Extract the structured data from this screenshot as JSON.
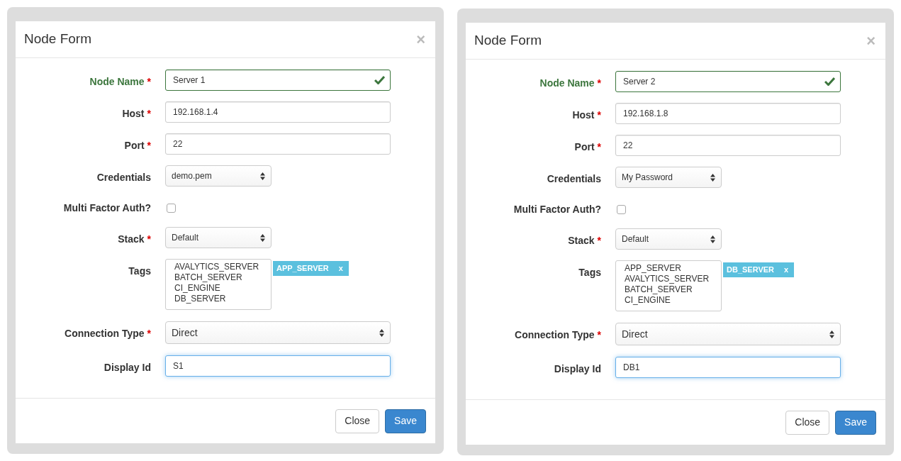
{
  "forms": [
    {
      "title": "Node Form",
      "close_symbol": "×",
      "fields": [
        {
          "kind": "text",
          "label": "Node Name",
          "required_mark": "*",
          "value": "Server 1",
          "valid": true,
          "focused": false
        },
        {
          "kind": "text",
          "label": "Host",
          "required_mark": "*",
          "value": "192.168.1.4",
          "valid": false,
          "focused": false
        },
        {
          "kind": "text",
          "label": "Port",
          "required_mark": "*",
          "value": "22",
          "valid": false,
          "focused": false
        },
        {
          "kind": "select",
          "label": "Credentials",
          "value": "demo.pem",
          "wide": false
        },
        {
          "kind": "checkbox",
          "label": "Multi Factor Auth?",
          "checked": false
        },
        {
          "kind": "select",
          "label": "Stack",
          "required_mark": "*",
          "value": "Default",
          "wide": false
        },
        {
          "kind": "listbox",
          "label": "Tags",
          "options": [
            "AVALYTICS_SERVER",
            "BATCH_SERVER",
            "CI_ENGINE",
            "DB_SERVER"
          ],
          "chips": [
            {
              "text": "APP_SERVER",
              "remove": "x"
            }
          ]
        },
        {
          "kind": "select",
          "label": "Connection Type",
          "required_mark": "*",
          "value": "Direct",
          "wide": true
        },
        {
          "kind": "text",
          "label": "Display Id",
          "value": "S1",
          "valid": false,
          "focused": true
        }
      ],
      "buttons": [
        {
          "label": "Close",
          "primary": false
        },
        {
          "label": "Save",
          "primary": true
        }
      ]
    },
    {
      "title": "Node Form",
      "close_symbol": "×",
      "fields": [
        {
          "kind": "text",
          "label": "Node Name",
          "required_mark": "*",
          "value": "Server 2",
          "valid": true,
          "focused": false
        },
        {
          "kind": "text",
          "label": "Host",
          "required_mark": "*",
          "value": "192.168.1.8",
          "valid": false,
          "focused": false
        },
        {
          "kind": "text",
          "label": "Port",
          "required_mark": "*",
          "value": "22",
          "valid": false,
          "focused": false
        },
        {
          "kind": "select",
          "label": "Credentials",
          "value": "My Password",
          "wide": false
        },
        {
          "kind": "checkbox",
          "label": "Multi Factor Auth?",
          "checked": false
        },
        {
          "kind": "select",
          "label": "Stack",
          "required_mark": "*",
          "value": "Default",
          "wide": false
        },
        {
          "kind": "listbox",
          "label": "Tags",
          "options": [
            "APP_SERVER",
            "AVALYTICS_SERVER",
            "BATCH_SERVER",
            "CI_ENGINE"
          ],
          "chips": [
            {
              "text": "DB_SERVER",
              "remove": "x"
            }
          ]
        },
        {
          "kind": "select",
          "label": "Connection Type",
          "required_mark": "*",
          "value": "Direct",
          "wide": true
        },
        {
          "kind": "text",
          "label": "Display Id",
          "value": "DB1",
          "valid": false,
          "focused": true
        }
      ],
      "buttons": [
        {
          "label": "Close",
          "primary": false
        },
        {
          "label": "Save",
          "primary": true
        }
      ]
    }
  ]
}
